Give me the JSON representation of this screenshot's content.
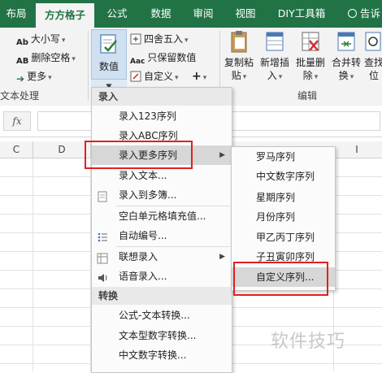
{
  "tabs": [
    {
      "label": "布局",
      "active": false
    },
    {
      "label": "方方格子",
      "active": true
    },
    {
      "label": "公式",
      "active": false
    },
    {
      "label": "数据",
      "active": false
    },
    {
      "label": "审阅",
      "active": false
    },
    {
      "label": "视图",
      "active": false
    },
    {
      "label": "DIY工具箱",
      "active": false
    }
  ],
  "tell_me": "告诉",
  "ribbon": {
    "text_group": {
      "size_label": "大小写",
      "delete_space_label": "删除空格",
      "more_label": "更多",
      "group_label": "文本处理"
    },
    "number_value_label": "数值",
    "numeric_group": {
      "round_label": "四舍五入",
      "keep_value_label": "只保留数值",
      "custom_label": "自定义",
      "plus_label": "+"
    },
    "edit_group": {
      "buttons": [
        {
          "line1": "复制粘",
          "line2": "贴"
        },
        {
          "line1": "新增插",
          "line2": "入"
        },
        {
          "line1": "批量删",
          "line2": "除"
        },
        {
          "line1": "合并转",
          "line2": "换"
        },
        {
          "line1": "查找",
          "line2": "位"
        }
      ],
      "group_label": "编辑"
    }
  },
  "formula_bar": {
    "fx_label": "fx",
    "value": ""
  },
  "columns": [
    "C",
    "D",
    "I"
  ],
  "menu": {
    "section_entry": "录入",
    "items_entry": [
      {
        "label": "录入123序列",
        "has_submenu": false
      },
      {
        "label": "录入ABC序列",
        "has_submenu": false
      },
      {
        "label": "录入更多序列",
        "has_submenu": true
      },
      {
        "label": "录入文本...",
        "has_submenu": false
      },
      {
        "label": "录入到多簿...",
        "has_submenu": false
      },
      {
        "label": "空白单元格填充值...",
        "has_submenu": false
      },
      {
        "label": "自动编号...",
        "has_submenu": false
      },
      {
        "label": "联想录入",
        "has_submenu": true
      },
      {
        "label": "语音录入...",
        "has_submenu": false
      }
    ],
    "section_convert": "转换",
    "items_convert": [
      {
        "label": "公式-文本转换..."
      },
      {
        "label": "文本型数字转换..."
      },
      {
        "label": "中文数字转换..."
      }
    ]
  },
  "submenu": {
    "items": [
      {
        "label": "罗马序列"
      },
      {
        "label": "中文数字序列"
      },
      {
        "label": "星期序列"
      },
      {
        "label": "月份序列"
      },
      {
        "label": "甲乙丙丁序列"
      },
      {
        "label": "子丑寅卯序列"
      },
      {
        "label": "自定义序列..."
      }
    ]
  },
  "watermark": "软件技巧",
  "colors": {
    "accent": "#217346",
    "highlight_border": "#e02020",
    "menu_hover": "#d7d7d7"
  }
}
